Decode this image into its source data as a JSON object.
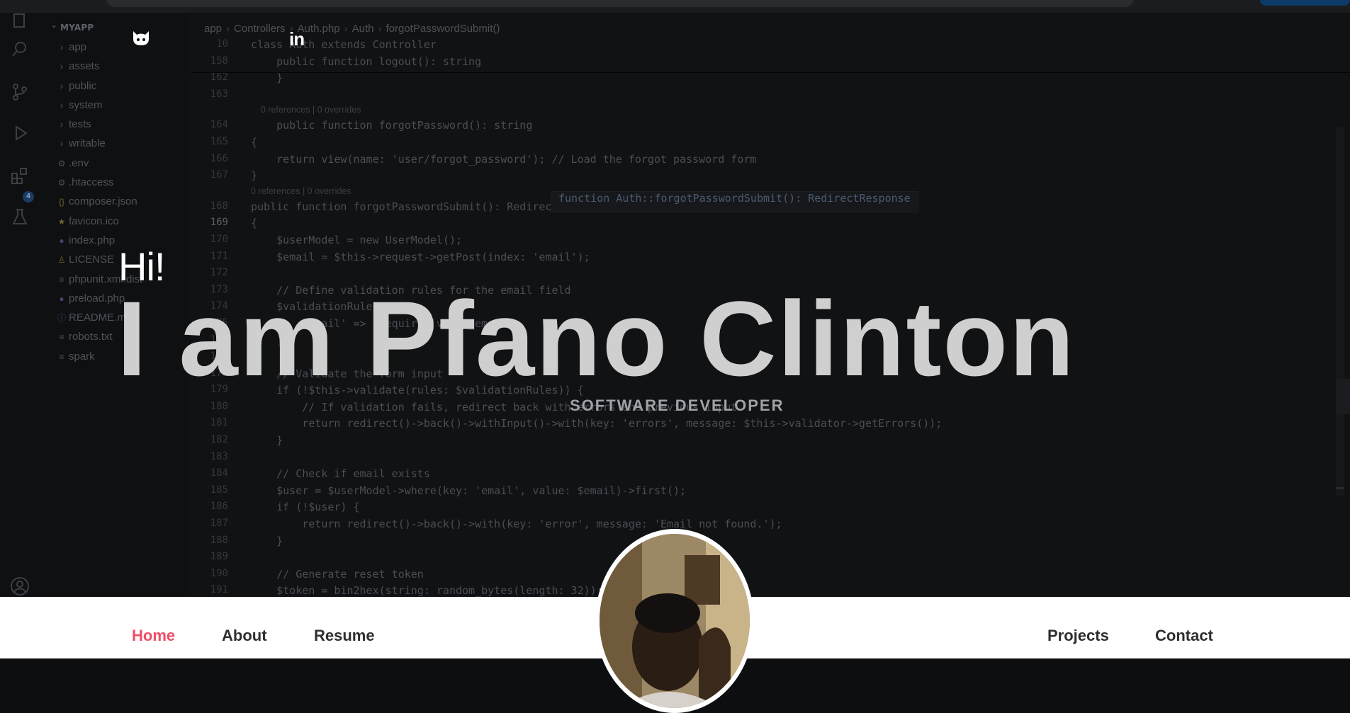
{
  "explorer": {
    "root": "MYAPP",
    "items": [
      {
        "label": "app",
        "type": "folder",
        "icon": "chevron-right-icon"
      },
      {
        "label": "assets",
        "type": "folder",
        "icon": "chevron-right-icon"
      },
      {
        "label": "public",
        "type": "folder",
        "icon": "chevron-right-icon"
      },
      {
        "label": "system",
        "type": "folder",
        "icon": "chevron-right-icon"
      },
      {
        "label": "tests",
        "type": "folder",
        "icon": "chevron-right-icon"
      },
      {
        "label": "writable",
        "type": "folder",
        "icon": "chevron-right-icon"
      },
      {
        "label": ".env",
        "type": "file",
        "icon": "gear-icon"
      },
      {
        "label": ".htaccess",
        "type": "file",
        "icon": "gear-icon"
      },
      {
        "label": "composer.json",
        "type": "file",
        "icon": "braces-icon"
      },
      {
        "label": "favicon.ico",
        "type": "file",
        "icon": "star-icon"
      },
      {
        "label": "index.php",
        "type": "file",
        "icon": "php-icon"
      },
      {
        "label": "LICENSE",
        "type": "file",
        "icon": "license-icon"
      },
      {
        "label": "phpunit.xml.dist",
        "type": "file",
        "icon": "lines-icon"
      },
      {
        "label": "preload.php",
        "type": "file",
        "icon": "php-icon"
      },
      {
        "label": "README.md",
        "type": "file",
        "icon": "info-icon"
      },
      {
        "label": "robots.txt",
        "type": "file",
        "icon": "lines-icon"
      },
      {
        "label": "spark",
        "type": "file",
        "icon": "lines-icon"
      }
    ]
  },
  "activity": {
    "extensions_badge": "4"
  },
  "breadcrumb": [
    "app",
    "Controllers",
    "Auth.php",
    "Auth",
    "forgotPasswordSubmit()"
  ],
  "tooltip": "function Auth::forgotPasswordSubmit(): RedirectResponse",
  "code_lines": [
    {
      "ln": "10",
      "text": "class Auth extends Controller"
    },
    {
      "ln": "158",
      "text": "    public function logout(): string"
    },
    {
      "ln": "162",
      "text": "    }"
    },
    {
      "ln": "163",
      "text": ""
    },
    {
      "ln": "",
      "text": "    0 references | 0 overrides",
      "hint": true
    },
    {
      "ln": "164",
      "text": "    public function forgotPassword(): string"
    },
    {
      "ln": "165",
      "text": "{"
    },
    {
      "ln": "166",
      "text": "    return view(name: 'user/forgot_password'); // Load the forgot password form"
    },
    {
      "ln": "167",
      "text": "}"
    },
    {
      "ln": "",
      "text": "0 references | 0 overrides",
      "hint": true
    },
    {
      "ln": "168",
      "text": "public function forgotPasswordSubmit(): RedirectResponse"
    },
    {
      "ln": "169",
      "text": "{",
      "current": true
    },
    {
      "ln": "170",
      "text": "    $userModel = new UserModel();"
    },
    {
      "ln": "171",
      "text": "    $email = $this->request->getPost(index: 'email');"
    },
    {
      "ln": "172",
      "text": ""
    },
    {
      "ln": "173",
      "text": "    // Define validation rules for the email field"
    },
    {
      "ln": "174",
      "text": "    $validationRules = ["
    },
    {
      "ln": "175",
      "text": "        'email' => 'required|valid_email'"
    },
    {
      "ln": "176",
      "text": "    ];"
    },
    {
      "ln": "177",
      "text": ""
    },
    {
      "ln": "178",
      "text": "    // Validate the form input"
    },
    {
      "ln": "179",
      "text": "    if (!$this->validate(rules: $validationRules)) {"
    },
    {
      "ln": "180",
      "text": "        // If validation fails, redirect back with errors and previous input"
    },
    {
      "ln": "181",
      "text": "        return redirect()->back()->withInput()->with(key: 'errors', message: $this->validator->getErrors());"
    },
    {
      "ln": "182",
      "text": "    }"
    },
    {
      "ln": "183",
      "text": ""
    },
    {
      "ln": "184",
      "text": "    // Check if email exists"
    },
    {
      "ln": "185",
      "text": "    $user = $userModel->where(key: 'email', value: $email)->first();"
    },
    {
      "ln": "186",
      "text": "    if (!$user) {"
    },
    {
      "ln": "187",
      "text": "        return redirect()->back()->with(key: 'error', message: 'Email not found.');"
    },
    {
      "ln": "188",
      "text": "    }"
    },
    {
      "ln": "189",
      "text": ""
    },
    {
      "ln": "190",
      "text": "    // Generate reset token"
    },
    {
      "ln": "191",
      "text": "    $token = bin2hex(string: random_bytes(length: 32));"
    }
  ],
  "hero": {
    "greeting": "Hi!",
    "name": "I am Pfano Clinton",
    "role": "SOFTWARE DEVELOPER",
    "social": {
      "github": "github-icon",
      "linkedin": "in"
    }
  },
  "nav": {
    "home": "Home",
    "about": "About",
    "resume": "Resume",
    "projects": "Projects",
    "contact": "Contact"
  },
  "colors": {
    "accent": "#f24c64",
    "nav_text": "#2f2f2f",
    "name_text": "#cfcfcf",
    "role_text": "#9fa3a8"
  }
}
